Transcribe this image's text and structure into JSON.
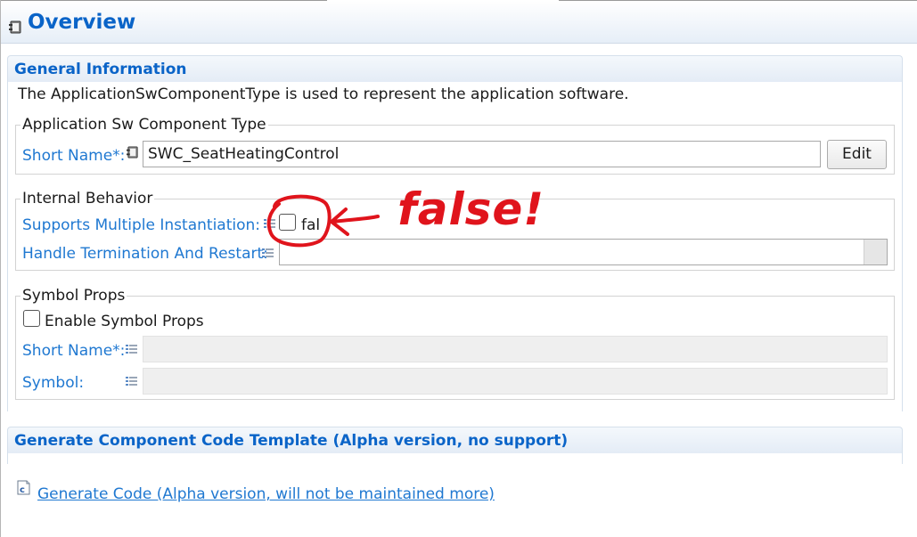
{
  "header": {
    "title": "Overview",
    "icon": "component-icon"
  },
  "general": {
    "section_title": "General Information",
    "description": "The ApplicationSwComponentType is used to represent the application software.",
    "app_group": {
      "legend": "Application Sw Component Type",
      "short_name_label": "Short Name*:",
      "short_name_value": "SWC_SeatHeatingControl",
      "edit_label": "Edit"
    },
    "internal_behavior": {
      "legend": "Internal Behavior",
      "multi_inst_label": "Supports Multiple Instantiation:",
      "multi_inst_checked": false,
      "multi_inst_value": "fal",
      "handle_label": "Handle Termination And Restart:",
      "handle_value": ""
    },
    "symbol_props": {
      "legend": "Symbol Props",
      "enable_label": "Enable Symbol Props",
      "enable_checked": false,
      "short_name_label": "Short Name*:",
      "short_name_value": "",
      "symbol_label": "Symbol:",
      "symbol_value": ""
    }
  },
  "codegen": {
    "section_title": "Generate Component Code Template (Alpha version, no support)",
    "link_label": "Generate Code (Alpha version, will not be maintained more)"
  },
  "annotation": {
    "text": "false!",
    "color": "#e0141c"
  },
  "colors": {
    "title_blue": "#0a64c8",
    "label_blue": "#1f78d1"
  }
}
